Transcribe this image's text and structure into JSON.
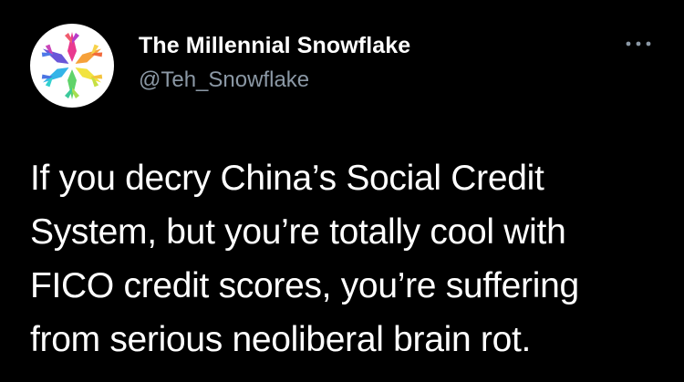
{
  "tweet": {
    "author": {
      "display_name": "The Millennial Snowflake",
      "handle": "@Teh_Snowflake",
      "avatar_icon": "snowflake-logo"
    },
    "more_icon": "more-dots-icon",
    "text_lines": [
      "If you decry China’s Social Credit",
      "System, but you’re totally cool with",
      "FICO credit scores, you’re suffering",
      "from serious neoliberal brain rot."
    ]
  },
  "colors": {
    "background": "#000000",
    "text_primary": "#ffffff",
    "text_secondary": "#8b98a5"
  }
}
